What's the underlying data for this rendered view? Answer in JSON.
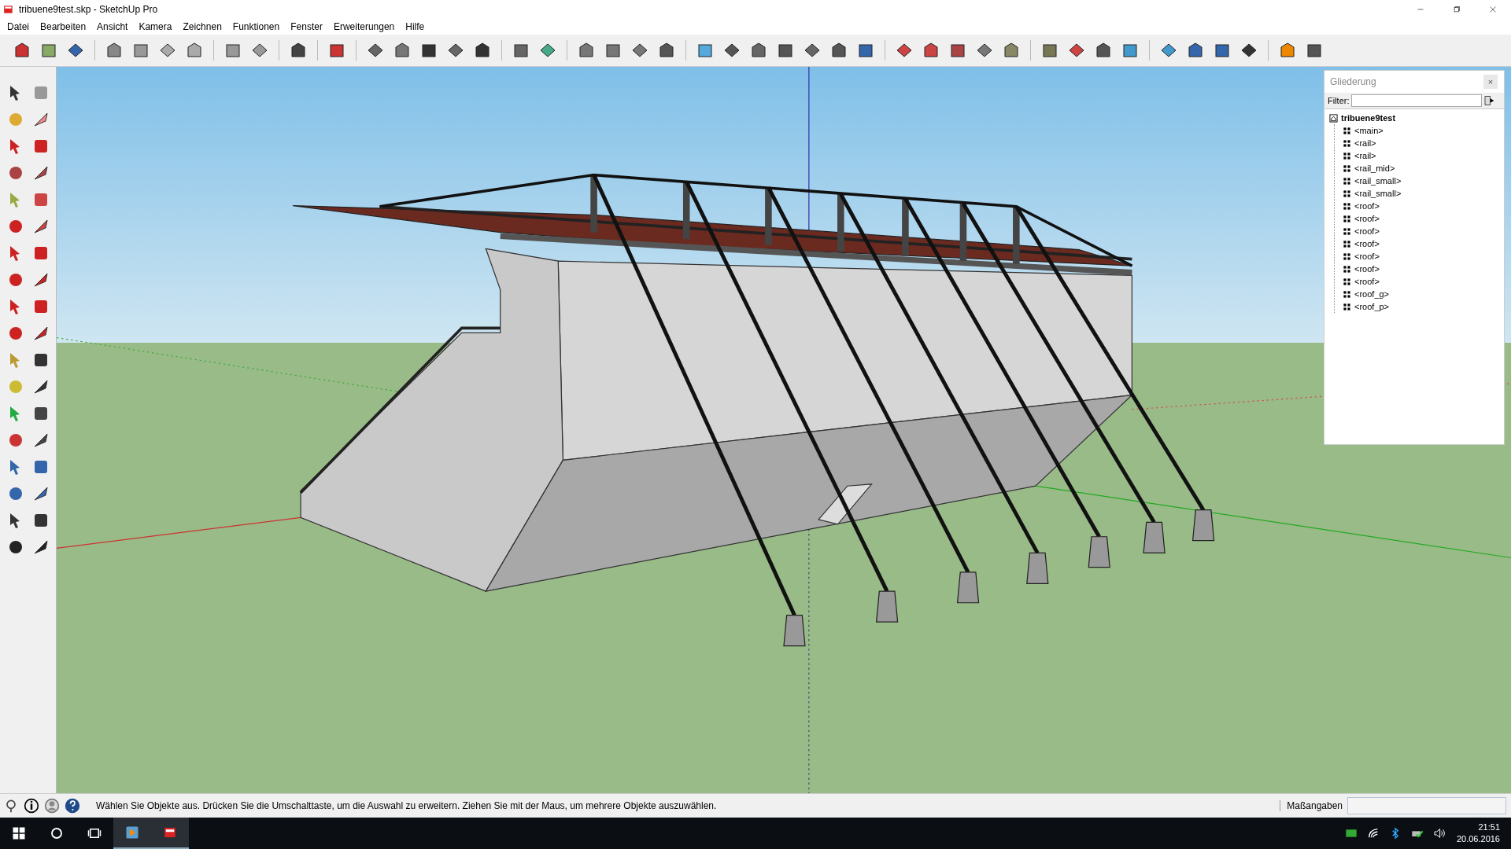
{
  "window": {
    "title": "tribuene9test.skp - SketchUp Pro"
  },
  "menu": [
    "Datei",
    "Bearbeiten",
    "Ansicht",
    "Kamera",
    "Zeichnen",
    "Funktionen",
    "Fenster",
    "Erweiterungen",
    "Hilfe"
  ],
  "outliner": {
    "title": "Gliederung",
    "close": "×",
    "filter_label": "Filter:",
    "tree": {
      "label": "tribuene9test",
      "children": [
        {
          "label": "<main>"
        },
        {
          "label": "<rail>"
        },
        {
          "label": "<rail>"
        },
        {
          "label": "<rail_mid>"
        },
        {
          "label": "<rail_small>"
        },
        {
          "label": "<rail_small>"
        },
        {
          "label": "<roof>"
        },
        {
          "label": "<roof>"
        },
        {
          "label": "<roof>"
        },
        {
          "label": "<roof>"
        },
        {
          "label": "<roof>"
        },
        {
          "label": "<roof>"
        },
        {
          "label": "<roof>"
        },
        {
          "label": "<roof_g>"
        },
        {
          "label": "<roof_p>"
        }
      ]
    }
  },
  "status_bar": {
    "hint": "Wählen Sie Objekte aus. Drücken Sie die Umschalttaste, um die Auswahl zu erweitern. Ziehen Sie mit der Maus, um mehrere Objekte auszuwählen.",
    "measurements_label": "Maßangaben"
  },
  "taskbar": {
    "time": "21:51",
    "date": "20.06.2016"
  }
}
